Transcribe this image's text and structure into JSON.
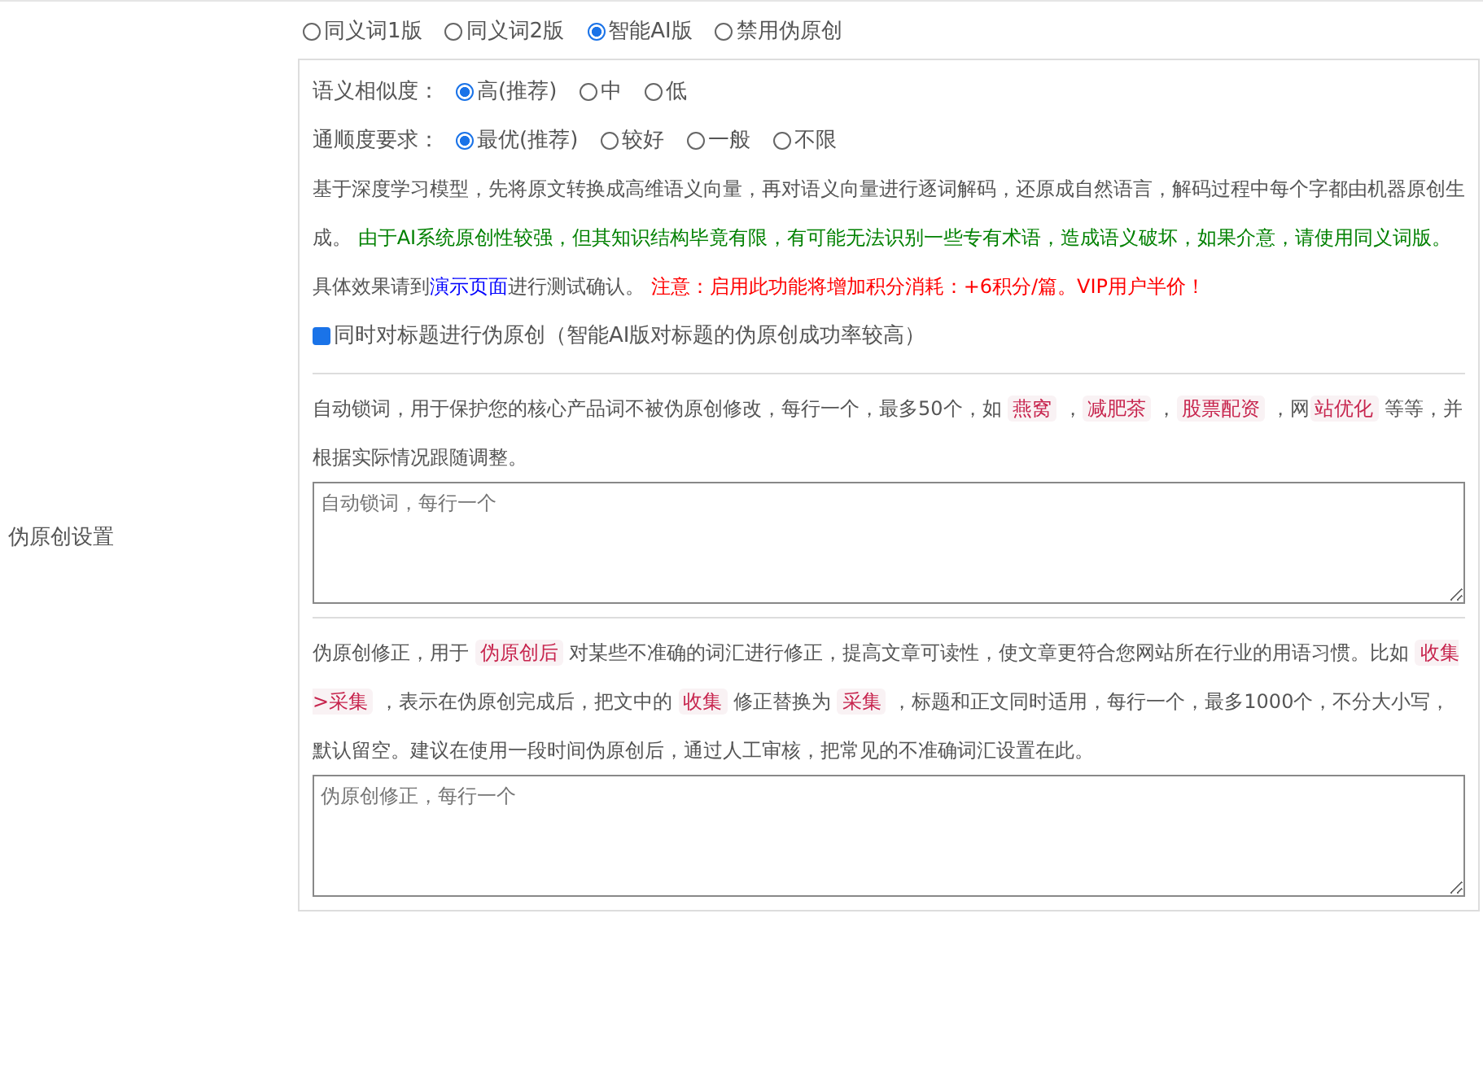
{
  "side_label": "伪原创设置",
  "modes": [
    {
      "label": "同义词1版",
      "selected": false
    },
    {
      "label": "同义词2版",
      "selected": false
    },
    {
      "label": "智能AI版",
      "selected": true
    },
    {
      "label": "禁用伪原创",
      "selected": false
    }
  ],
  "option_groups": [
    {
      "label": "语义相似度：",
      "options": [
        {
          "label": "高(推荐)",
          "selected": true
        },
        {
          "label": "中",
          "selected": false
        },
        {
          "label": "低",
          "selected": false
        }
      ]
    },
    {
      "label": "通顺度要求：",
      "options": [
        {
          "label": "最优(推荐)",
          "selected": true
        },
        {
          "label": "较好",
          "selected": false
        },
        {
          "label": "一般",
          "selected": false
        },
        {
          "label": "不限",
          "selected": false
        }
      ]
    }
  ],
  "ai_description": [
    {
      "kind": "text",
      "text": "基于深度学习模型，先将原文转换成高维语义向量，再对语义向量进行逐词解码，还原成自然语言，解码过程中每个字都由机器原创生成。 "
    },
    {
      "kind": "green",
      "text": "由于AI系统原创性较强，但其知识结构毕竟有限，有可能无法识别一些专有术语，造成语义破坏，如果介意，请使用同义词版。"
    },
    {
      "kind": "text",
      "text": " 具体效果请到"
    },
    {
      "kind": "link",
      "text": "演示页面"
    },
    {
      "kind": "text",
      "text": "进行测试确认。 "
    },
    {
      "kind": "red",
      "text": "注意：启用此功能将增加积分消耗：+6积分/篇。VIP用户半价！"
    }
  ],
  "title_option": {
    "label": "同时对标题进行伪原创（智能AI版对标题的伪原创成功率较高）",
    "checked": true
  },
  "lock_description": [
    {
      "kind": "text",
      "text": "自动锁词，用于保护您的核心产品词不被伪原创修改，每行一个，最多50个，如 "
    },
    {
      "kind": "code",
      "text": "燕窝"
    },
    {
      "kind": "text",
      "text": " ，"
    },
    {
      "kind": "code",
      "text": "减肥茶"
    },
    {
      "kind": "text",
      "text": " ，"
    },
    {
      "kind": "code",
      "text": "股票配资"
    },
    {
      "kind": "text",
      "text": " ，网"
    },
    {
      "kind": "code",
      "text": "站优化"
    },
    {
      "kind": "text",
      "text": " 等等，并根据实际情况跟随调整。"
    }
  ],
  "lock_field": {
    "placeholder": "自动锁词，每行一个"
  },
  "fix_description": [
    {
      "kind": "text",
      "text": "伪原创修正，用于 "
    },
    {
      "kind": "code",
      "text": "伪原创后"
    },
    {
      "kind": "text",
      "text": " 对某些不准确的词汇进行修正，提高文章可读性，使文章更符合您网站所在行业的用语习惯。比如 "
    },
    {
      "kind": "code",
      "text": "收集>采集"
    },
    {
      "kind": "text",
      "text": " ，表示在伪原创完成后，把文中的 "
    },
    {
      "kind": "code",
      "text": "收集"
    },
    {
      "kind": "text",
      "text": " 修正替换为 "
    },
    {
      "kind": "code",
      "text": "采集"
    },
    {
      "kind": "text",
      "text": " ，标题和正文同时适用，每行一个，最多1000个，不分大小写，默认留空。建议在使用一段时间伪原创后，通过人工审核，把常见的不准确词汇设置在此。"
    }
  ],
  "fix_field": {
    "placeholder": "伪原创修正，每行一个"
  }
}
